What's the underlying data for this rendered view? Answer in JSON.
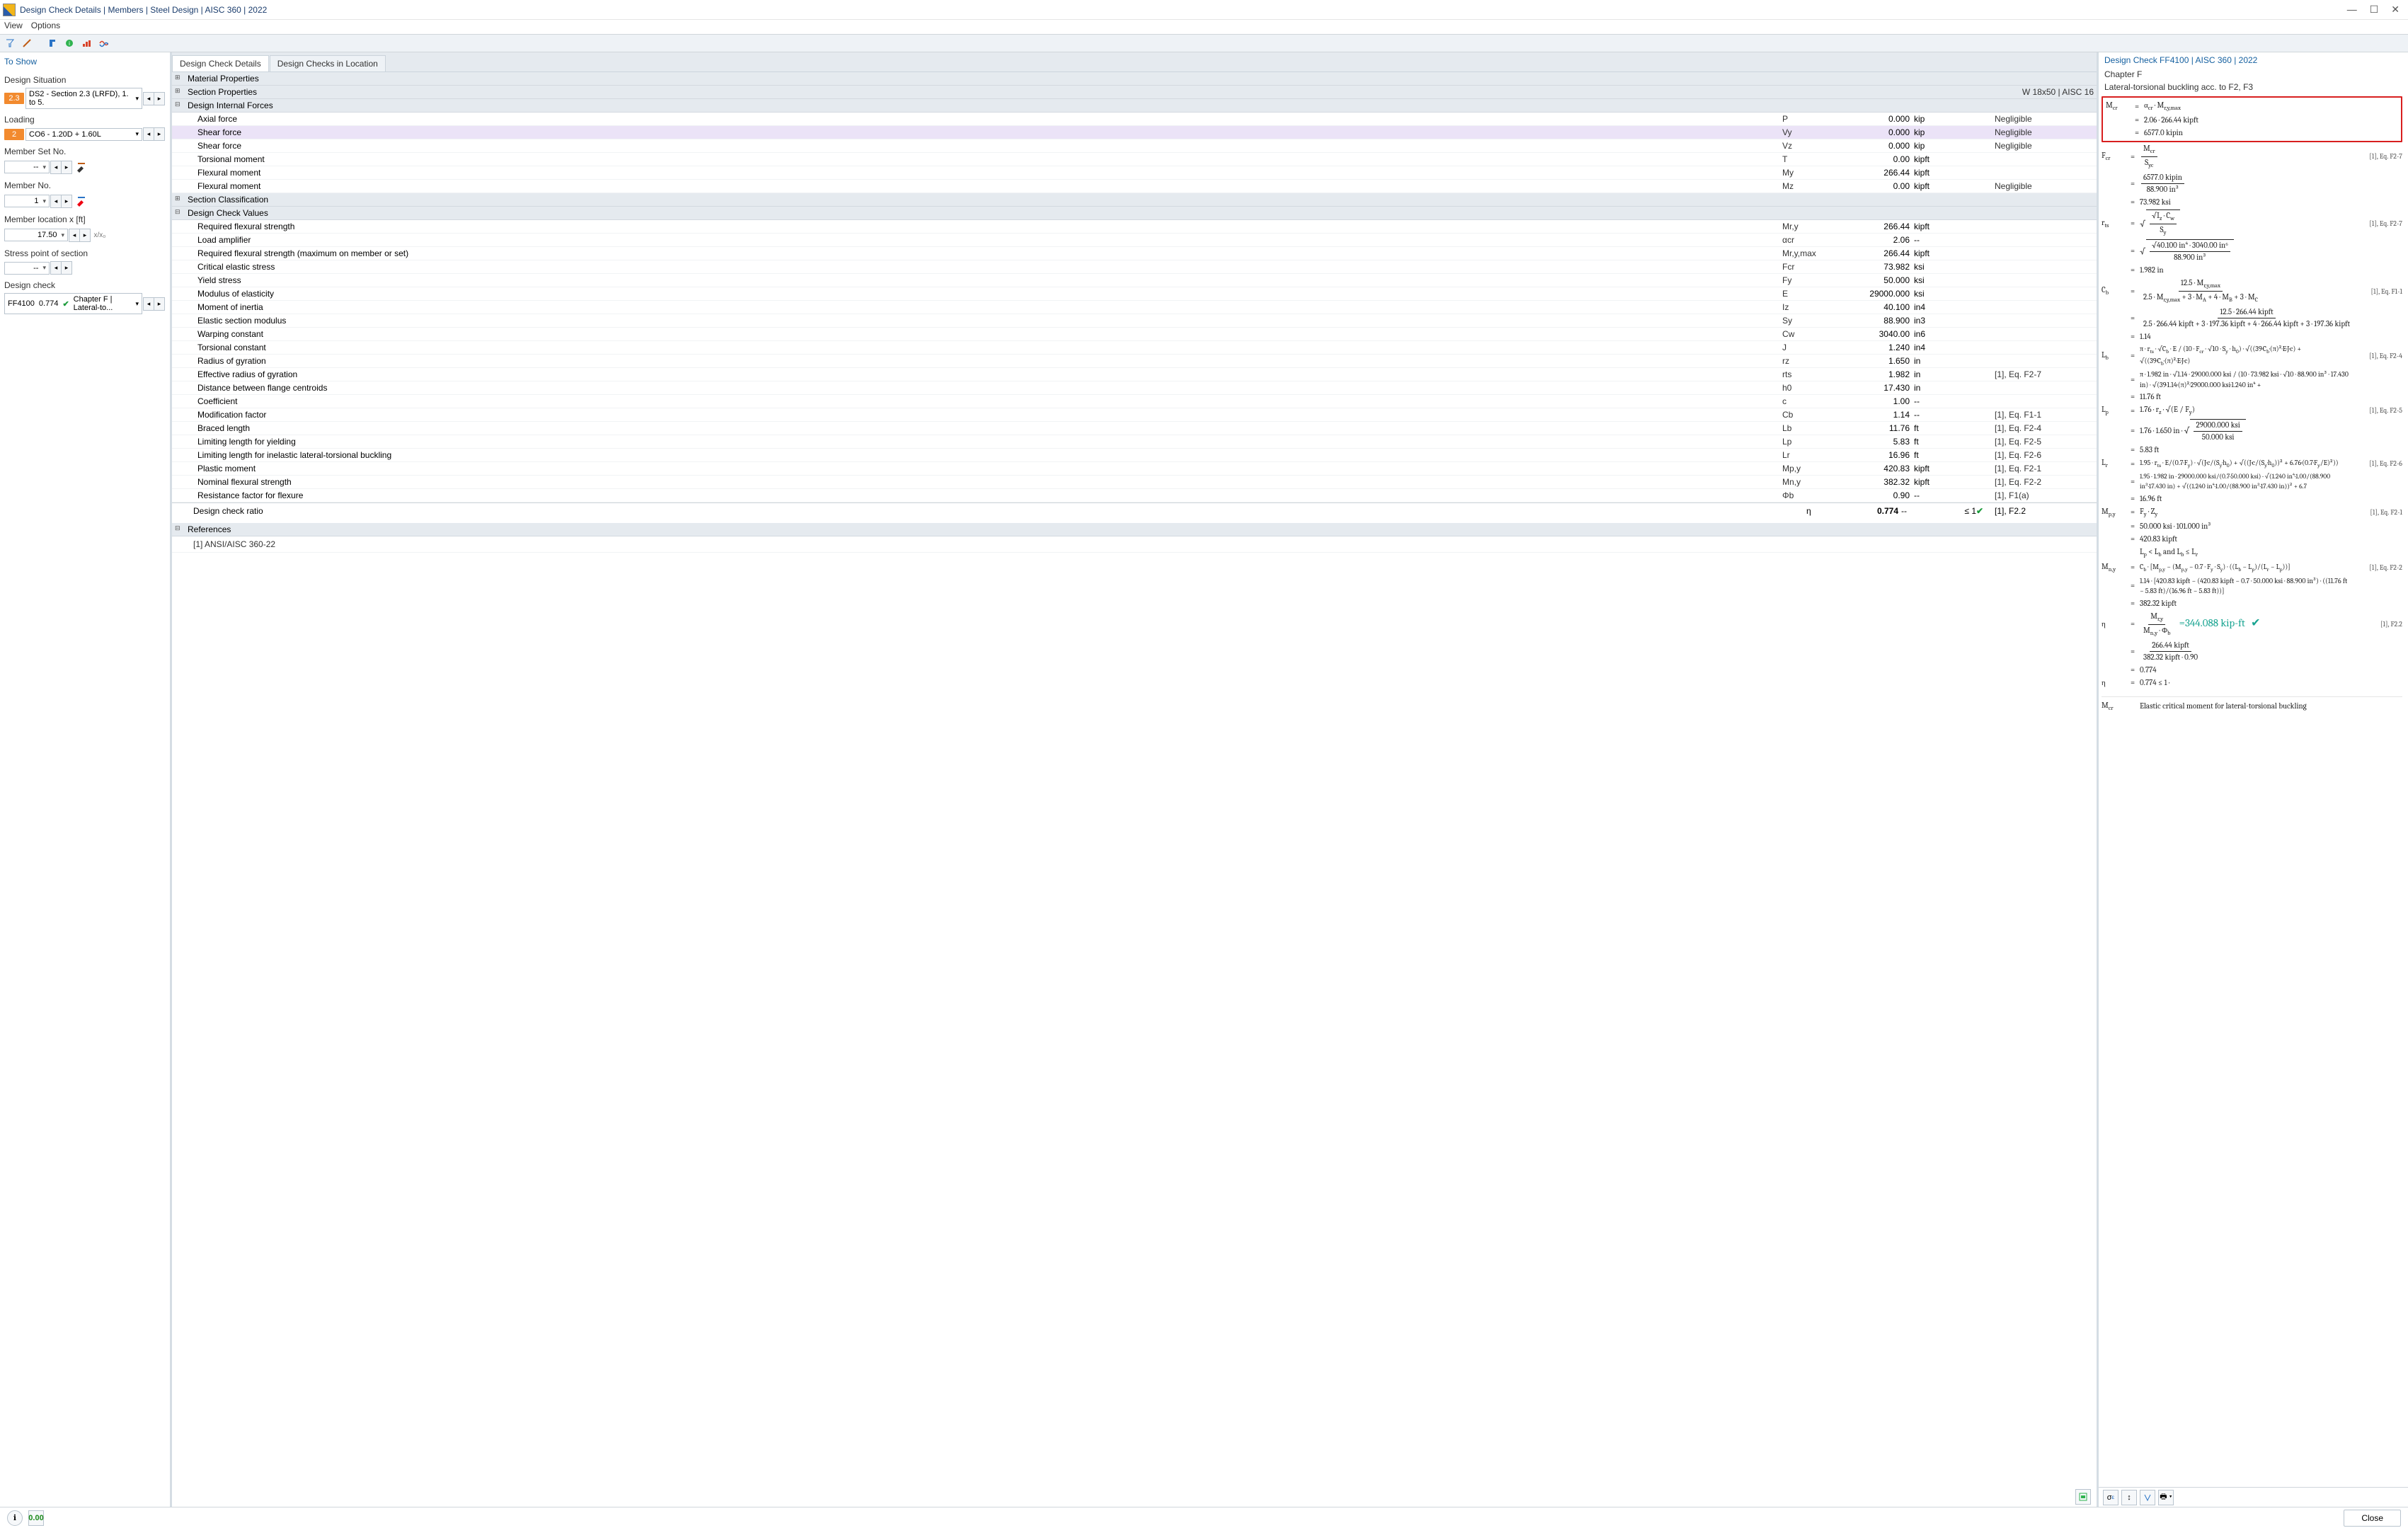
{
  "window": {
    "title": "Design Check Details | Members | Steel Design | AISC 360 | 2022"
  },
  "menu": {
    "view": "View",
    "options": "Options"
  },
  "left": {
    "header": "To Show",
    "design_situation_label": "Design Situation",
    "ds_pill": "2.3",
    "ds_text": "DS2 - Section 2.3 (LRFD), 1. to 5.",
    "loading_label": "Loading",
    "co_pill": "2",
    "co_text": "CO6 - 1.20D + 1.60L",
    "member_set_label": "Member Set No.",
    "member_set_value": "-- ",
    "member_no_label": "Member No.",
    "member_no_value": "1",
    "member_loc_label": "Member location x [ft]",
    "member_loc_value": "17.50",
    "loc_extra": "x/x₀",
    "stress_point_label": "Stress point of section",
    "stress_point_value": "-- ",
    "design_check_label": "Design check",
    "dc_code": "FF4100",
    "dc_ratio": "0.774",
    "dc_title_full": "Chapter F | Lateral-to..."
  },
  "tabs": {
    "t1": "Design Check Details",
    "t2": "Design Checks in Location"
  },
  "sections": {
    "mat": "Material Properties",
    "sec": "Section Properties",
    "sec_badge": "W 18x50 | AISC 16",
    "dif": "Design Internal Forces",
    "scls": "Section Classification",
    "dcv": "Design Check Values",
    "refs": "References",
    "ref1": "[1]  ANSI/AISC 360-22"
  },
  "forces": [
    {
      "n": "Axial force",
      "s": "P",
      "v": "0.000",
      "u": "kip",
      "r": "Negligible"
    },
    {
      "n": "Shear force",
      "s": "Vy",
      "v": "0.000",
      "u": "kip",
      "r": "Negligible",
      "sel": true
    },
    {
      "n": "Shear force",
      "s": "Vz",
      "v": "0.000",
      "u": "kip",
      "r": "Negligible"
    },
    {
      "n": "Torsional moment",
      "s": "T",
      "v": "0.00",
      "u": "kipft",
      "r": ""
    },
    {
      "n": "Flexural moment",
      "s": "My",
      "v": "266.44",
      "u": "kipft",
      "r": ""
    },
    {
      "n": "Flexural moment",
      "s": "Mz",
      "v": "0.00",
      "u": "kipft",
      "r": "Negligible"
    }
  ],
  "values": [
    {
      "n": "Required flexural strength",
      "s": "Mr,y",
      "v": "266.44",
      "u": "kipft",
      "r": ""
    },
    {
      "n": "Load amplifier",
      "s": "αcr",
      "v": "2.06",
      "u": "--",
      "r": ""
    },
    {
      "n": "Required flexural strength (maximum on member or set)",
      "s": "Mr,y,max",
      "v": "266.44",
      "u": "kipft",
      "r": ""
    },
    {
      "n": "Critical elastic stress",
      "s": "Fcr",
      "v": "73.982",
      "u": "ksi",
      "r": ""
    },
    {
      "n": "Yield stress",
      "s": "Fy",
      "v": "50.000",
      "u": "ksi",
      "r": ""
    },
    {
      "n": "Modulus of elasticity",
      "s": "E",
      "v": "29000.000",
      "u": "ksi",
      "r": ""
    },
    {
      "n": "Moment of inertia",
      "s": "Iz",
      "v": "40.100",
      "u": "in4",
      "r": ""
    },
    {
      "n": "Elastic section modulus",
      "s": "Sy",
      "v": "88.900",
      "u": "in3",
      "r": ""
    },
    {
      "n": "Warping constant",
      "s": "Cw",
      "v": "3040.00",
      "u": "in6",
      "r": ""
    },
    {
      "n": "Torsional constant",
      "s": "J",
      "v": "1.240",
      "u": "in4",
      "r": ""
    },
    {
      "n": "Radius of gyration",
      "s": "rz",
      "v": "1.650",
      "u": "in",
      "r": ""
    },
    {
      "n": "Effective radius of gyration",
      "s": "rts",
      "v": "1.982",
      "u": "in",
      "r": "[1], Eq. F2-7"
    },
    {
      "n": "Distance between flange centroids",
      "s": "h0",
      "v": "17.430",
      "u": "in",
      "r": ""
    },
    {
      "n": "Coefficient",
      "s": "c",
      "v": "1.00",
      "u": "--",
      "r": ""
    },
    {
      "n": "Modification factor",
      "s": "Cb",
      "v": "1.14",
      "u": "--",
      "r": "[1], Eq. F1-1"
    },
    {
      "n": "Braced length",
      "s": "Lb",
      "v": "11.76",
      "u": "ft",
      "r": "[1], Eq. F2-4"
    },
    {
      "n": "Limiting length for yielding",
      "s": "Lp",
      "v": "5.83",
      "u": "ft",
      "r": "[1], Eq. F2-5"
    },
    {
      "n": "Limiting length for inelastic lateral-torsional buckling",
      "s": "Lr",
      "v": "16.96",
      "u": "ft",
      "r": "[1], Eq. F2-6"
    },
    {
      "n": "Plastic moment",
      "s": "Mp,y",
      "v": "420.83",
      "u": "kipft",
      "r": "[1], Eq. F2-1"
    },
    {
      "n": "Nominal flexural strength",
      "s": "Mn,y",
      "v": "382.32",
      "u": "kipft",
      "r": "[1], Eq. F2-2"
    },
    {
      "n": "Resistance factor for flexure",
      "s": "Φb",
      "v": "0.90",
      "u": "--",
      "r": "[1], F1(a)"
    }
  ],
  "ratio": {
    "label": "Design check ratio",
    "sym": "η",
    "val": "0.774",
    "dash": "--",
    "le": "≤ 1",
    "ref": "[1], F2.2"
  },
  "right": {
    "header": "Design Check FF4100 | AISC 360 | 2022",
    "sub1": "Chapter F",
    "sub2": "Lateral-torsional buckling acc. to F2, F3",
    "result": "=344.088 kip-ft",
    "final_note": "Elastic critical moment for lateral-torsional buckling",
    "eq": {
      "mcr1": "α<sub>cr</sub> · M<sub>r,y,max</sub>",
      "mcr2": "2.06 · 266.44 kipft",
      "mcr3": "6577.0 kipin",
      "fcr_num": "M<sub>cr</sub>",
      "fcr_den": "S<sub>yc</sub>",
      "fcr2_num": "6577.0 kipin",
      "fcr2_den": "88.900 in³",
      "fcr3": "73.982 ksi",
      "rts_num": "√I<sub>z</sub> · C<sub>w</sub>",
      "rts_den": "S<sub>y</sub>",
      "rts2_num": "√40.100 in⁴ · 3040.00 in⁶",
      "rts2_den": "88.900 in³",
      "rts3": "1.982 in",
      "cb_num": "12.5 · M<sub>r,y,max</sub>",
      "cb_den": "2.5 · M<sub>r,y,max</sub> + 3 · M<sub>A</sub> + 4 · M<sub>B</sub> + 3 · M<sub>C</sub>",
      "cb2_num": "12.5 · 266.44 kipft",
      "cb2_den": "2.5 · 266.44 kipft + 3 · 197.36 kipft + 4 · 266.44 kipft + 3 · 197.36 kipft",
      "cb3": "1.14",
      "lb_line": "π · r<sub>ts</sub> · √C<sub>b</sub> · E / (10 · F<sub>cr</sub> · √10 · S<sub>y</sub> · h<sub>0</sub>) · √((39·C<sub>b</sub>·(π)²·E·J·c) + √((39·C<sub>b</sub>·(π)²·E·J·c)",
      "lb2": "π · 1.982 in · √1.14 · 29000.000 ksi / (10 · 73.982 ksi · √10 · 88.900 in³ · 17.430 in) · √(39·1.14·(π)²·29000.000 ksi·1.240 in⁴ + ",
      "lb3": "11.76 ft",
      "lp_line": "1.76 · r<sub>z</sub> · √(E / F<sub>y</sub>)",
      "lp2": "1.76 · 1.650 in · √(29000.000 ksi / 50.000 ksi)",
      "lp3": "5.83 ft",
      "lr_line": "1.95 · r<sub>ts</sub> · E/(0.7·F<sub>y</sub>) · √(J·c/(S<sub>y</sub>·h<sub>0</sub>) + √((J·c/(S<sub>y</sub>·h<sub>0</sub>))² + 6.76·(0.7·F<sub>y</sub>/E)²))",
      "lr2": "1.95 · 1.982 in · 29000.000 ksi/(0.7·50.000 ksi) · √(1.240 in⁴·1.00/(88.900 in³·17.430 in) + √((1.240 in⁴·1.00/(88.900 in³·17.430 in))² + 6.7",
      "lr3": "16.96 ft",
      "mpy_line": "F<sub>y</sub> · Z<sub>y</sub>",
      "mpy2": "50.000 ksi · 101.000 in³",
      "mpy3": "420.83 kipft",
      "cond": "L<sub>p</sub> &lt; L<sub>b</sub> and L<sub>b</sub> ≤ L<sub>r</sub>",
      "mny_line": "C<sub>b</sub> · [M<sub>p,y</sub> − (M<sub>p,y</sub> − 0.7 · F<sub>y</sub> · S<sub>y</sub>) · ((L<sub>b</sub> − L<sub>p</sub>)/(L<sub>r</sub> − L<sub>p</sub>))]",
      "mny2": "1.14 · [420.83 kipft − (420.83 kipft − 0.7 · 50.000 ksi · 88.900 in³) · ((11.76 ft − 5.83 ft)/(16.96 ft − 5.83 ft))]",
      "mny3": "382.32 kipft",
      "eta_line": "M<sub>r,y</sub> / (M<sub>n,y</sub> · Φ<sub>b</sub>)",
      "eta2": "266.44 kipft / (382.32 kipft · 0.90)",
      "eta3": "0.774",
      "eta4": "0.774 ≤ 1 ·"
    },
    "refs": {
      "f27": "[1], Eq. F2-7",
      "f11": "[1], Eq. F1-1",
      "f24": "[1], Eq. F2-4",
      "f25": "[1], Eq. F2-5",
      "f26": "[1], Eq. F2-6",
      "f21": "[1], Eq. F2-1",
      "f22": "[1], Eq. F2-2",
      "f22b": "[1], F2.2"
    }
  },
  "footer": {
    "close": "Close"
  }
}
